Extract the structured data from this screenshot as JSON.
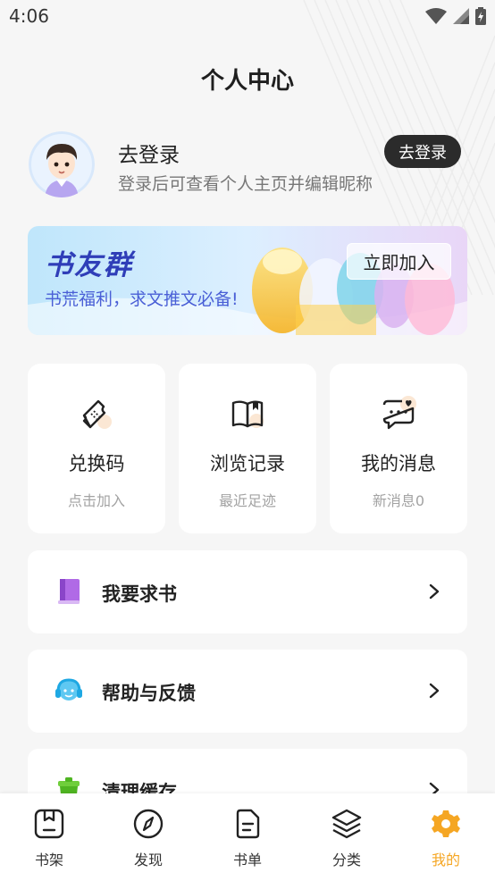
{
  "status_bar": {
    "time": "4:06"
  },
  "page": {
    "title": "个人中心"
  },
  "profile": {
    "title": "去登录",
    "subtitle": "登录后可查看个人主页并编辑昵称",
    "login_button": "去登录"
  },
  "banner": {
    "title": "书友群",
    "subtitle": "书荒福利，求文推文必备!",
    "join_button": "立即加入"
  },
  "cards": [
    {
      "label": "兑换码",
      "sub": "点击加入",
      "icon": "ticket-icon"
    },
    {
      "label": "浏览记录",
      "sub": "最近足迹",
      "icon": "book-open-icon"
    },
    {
      "label": "我的消息",
      "sub": "新消息0",
      "icon": "message-heart-icon"
    }
  ],
  "menu": [
    {
      "label": "我要求书",
      "icon": "book-request-icon"
    },
    {
      "label": "帮助与反馈",
      "icon": "headset-icon"
    },
    {
      "label": "清理缓存",
      "icon": "trash-icon"
    }
  ],
  "nav": [
    {
      "label": "书架",
      "icon": "bookshelf-icon"
    },
    {
      "label": "发现",
      "icon": "compass-icon"
    },
    {
      "label": "书单",
      "icon": "booklist-icon"
    },
    {
      "label": "分类",
      "icon": "layers-icon"
    },
    {
      "label": "我的",
      "icon": "gear-icon",
      "active": true
    }
  ],
  "colors": {
    "accent": "#f5a623",
    "banner_title": "#2f3eb8",
    "dark_button": "#2b2b2b"
  }
}
